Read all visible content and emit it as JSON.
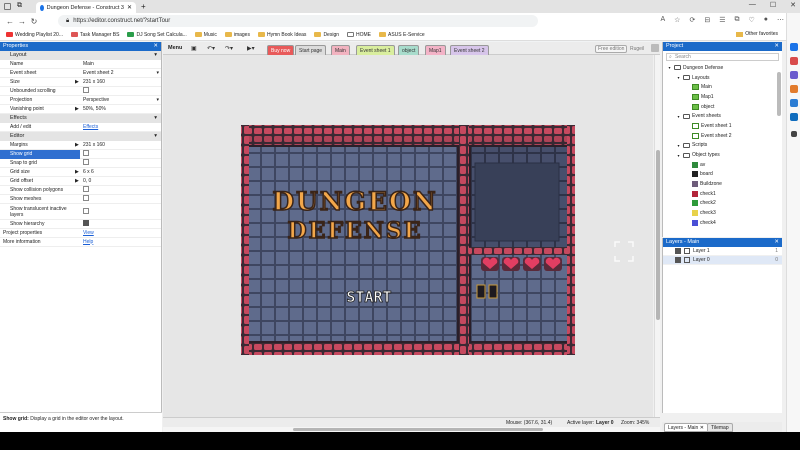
{
  "browser": {
    "tab_title": "Dungeon Defense - Construct 3",
    "url": "https://editor.construct.net/?startTour",
    "window_controls": [
      "—",
      "☐",
      "✕"
    ],
    "bookmarks": [
      {
        "label": "Wedding Playlist 20...",
        "icon": "youtube-icon"
      },
      {
        "label": "Task Manager BS",
        "icon": "red-icon"
      },
      {
        "label": "DJ Song Set Calcula...",
        "icon": "sheets-icon"
      },
      {
        "label": "Music",
        "icon": "folder-icon"
      },
      {
        "label": "images",
        "icon": "folder-icon"
      },
      {
        "label": "Hymn Book Ideas",
        "icon": "folder-icon"
      },
      {
        "label": "Design",
        "icon": "folder-icon"
      },
      {
        "label": "HOME",
        "icon": "doc-icon"
      },
      {
        "label": "ASUS E-Service",
        "icon": "folder-icon"
      }
    ],
    "other_favorites": "Other favorites"
  },
  "properties": {
    "header": "Properties",
    "layout_section": "Layout",
    "rows_layout": [
      {
        "k": "Name",
        "v": "Main"
      },
      {
        "k": "Event sheet",
        "v": "Event sheet 2"
      },
      {
        "k": "Size",
        "v": "231 x 160"
      },
      {
        "k": "Unbounded scrolling",
        "v": ""
      },
      {
        "k": "Projection",
        "v": "Perspective"
      },
      {
        "k": "Vanishing point",
        "v": "50%, 50%"
      }
    ],
    "effects_section": "Effects",
    "add_edit": "Add / edit",
    "effects_link": "Effects",
    "editor_section": "Editor",
    "rows_editor": [
      {
        "k": "Margins",
        "v": "231 x 160"
      },
      {
        "k": "Show grid",
        "v": ""
      },
      {
        "k": "Snap to grid",
        "v": ""
      },
      {
        "k": "Grid size",
        "v": "6 x 6"
      },
      {
        "k": "Grid offset",
        "v": "0, 0"
      },
      {
        "k": "Show collision polygons",
        "v": ""
      },
      {
        "k": "Show meshes",
        "v": ""
      },
      {
        "k": "Show translucent inactive layers",
        "v": ""
      },
      {
        "k": "Show hierarchy",
        "v": ""
      }
    ],
    "project_properties": "Project properties",
    "view_link": "View",
    "more_information": "More information",
    "help_link": "Help",
    "help_title": "Show grid:",
    "help_text": "Display a grid in the editor over the layout."
  },
  "toolbar": {
    "menu": "Menu",
    "tabs": [
      {
        "label": "Buy now",
        "color": "#e85a5a",
        "text": "#fff"
      },
      {
        "label": "Start page",
        "color": "#dcdcdc",
        "text": "#333"
      },
      {
        "label": "Main",
        "color": "#f2b3c0",
        "text": "#333"
      },
      {
        "label": "Event sheet 1",
        "color": "#d9ee9e",
        "text": "#333"
      },
      {
        "label": "object",
        "color": "#a8dccc",
        "text": "#333"
      },
      {
        "label": "Map1",
        "color": "#f3b3c7",
        "text": "#333"
      },
      {
        "label": "Event sheet 2",
        "color": "#d7c5ea",
        "text": "#333"
      }
    ],
    "free_edition": "Free edition",
    "free_label": "Rugeil"
  },
  "game": {
    "title_line1": "DUNGEON",
    "title_line2": "DEFENSE",
    "start": "START"
  },
  "status": {
    "mouse": "Mouse: (367.6, 31.4)",
    "active_layer_label": "Active layer:",
    "active_layer": "Layer 0",
    "zoom": "Zoom: 345%"
  },
  "project": {
    "header": "Project",
    "search_placeholder": "Search",
    "tree": [
      {
        "label": "Dungeon Defense",
        "indent": 0,
        "type": "root"
      },
      {
        "label": "Layouts",
        "indent": 1,
        "type": "folder"
      },
      {
        "label": "Main",
        "indent": 2,
        "type": "layout"
      },
      {
        "label": "Map1",
        "indent": 2,
        "type": "layout"
      },
      {
        "label": "object",
        "indent": 2,
        "type": "layout"
      },
      {
        "label": "Event sheets",
        "indent": 1,
        "type": "folder"
      },
      {
        "label": "Event sheet 1",
        "indent": 2,
        "type": "event"
      },
      {
        "label": "Event sheet 2",
        "indent": 2,
        "type": "event"
      },
      {
        "label": "Scripts",
        "indent": 1,
        "type": "folder"
      },
      {
        "label": "Object types",
        "indent": 1,
        "type": "folder"
      },
      {
        "label": "av",
        "indent": 2,
        "type": "obj",
        "color": "#2f8a3c"
      },
      {
        "label": "board",
        "indent": 2,
        "type": "obj",
        "color": "#222222"
      },
      {
        "label": "Buildzone",
        "indent": 2,
        "type": "obj",
        "color": "#6e5c7a"
      },
      {
        "label": "check1",
        "indent": 2,
        "type": "obj",
        "color": "#b3243a"
      },
      {
        "label": "check2",
        "indent": 2,
        "type": "obj",
        "color": "#2e9a3a"
      },
      {
        "label": "check3",
        "indent": 2,
        "type": "obj",
        "color": "#e8d24a"
      },
      {
        "label": "check4",
        "indent": 2,
        "type": "obj",
        "color": "#4a4fd6"
      }
    ]
  },
  "layers": {
    "header": "Layers - Main",
    "rows": [
      {
        "label": "Layer 1",
        "num": "1"
      },
      {
        "label": "Layer 0",
        "num": "0"
      }
    ],
    "bottom_tabs": [
      "Layers - Main",
      "Tilemap"
    ]
  }
}
